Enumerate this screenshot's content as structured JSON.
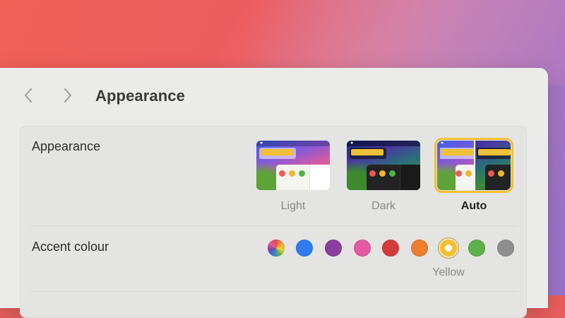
{
  "window": {
    "title": "Appearance"
  },
  "nav": {
    "back": "chevron-left-icon",
    "forward": "chevron-right-icon"
  },
  "appearance": {
    "label": "Appearance",
    "options": [
      {
        "label": "Light",
        "selected": false
      },
      {
        "label": "Dark",
        "selected": false
      },
      {
        "label": "Auto",
        "selected": true
      }
    ]
  },
  "accent": {
    "label": "Accent colour",
    "colors": [
      {
        "name": "multicolour",
        "hex": "multicolor"
      },
      {
        "name": "blue",
        "hex": "#2f7bf0"
      },
      {
        "name": "purple",
        "hex": "#8a3ea0"
      },
      {
        "name": "pink",
        "hex": "#e55aa0"
      },
      {
        "name": "red",
        "hex": "#d63a3a"
      },
      {
        "name": "orange",
        "hex": "#ec7e2e"
      },
      {
        "name": "yellow",
        "hex": "#f3c02f"
      },
      {
        "name": "green",
        "hex": "#5eb04a"
      },
      {
        "name": "graphite",
        "hex": "#8e8e8e"
      }
    ],
    "selected": "Yellow"
  }
}
